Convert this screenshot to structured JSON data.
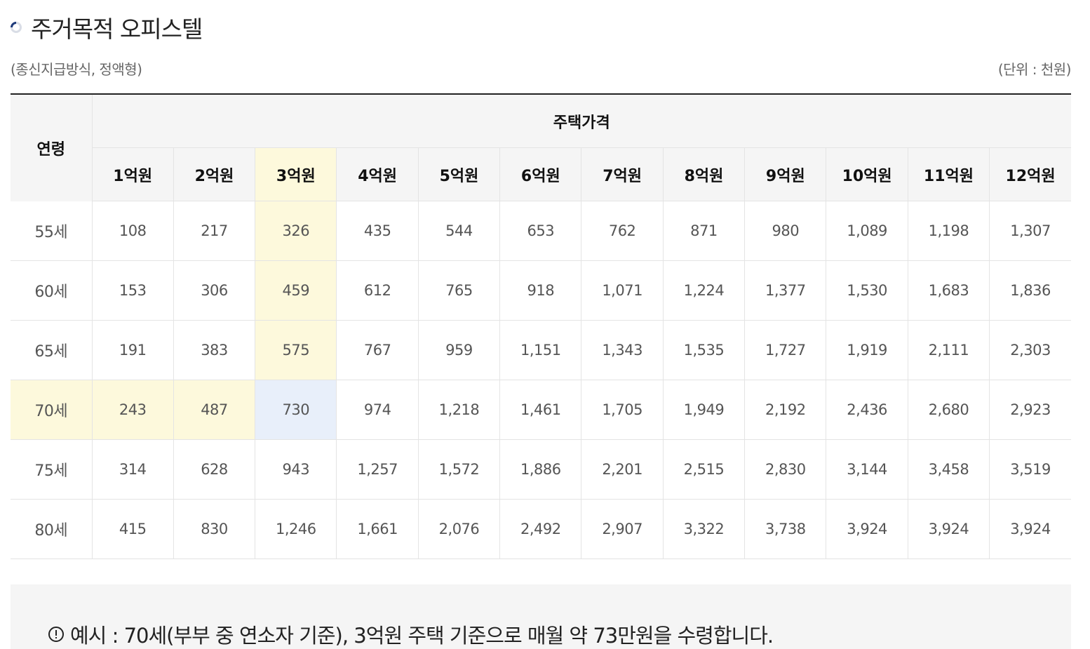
{
  "header": {
    "title": "주거목적 오피스텔",
    "subtitle": "(종신지급방식, 정액형)",
    "unit": "(단위 : 천원)"
  },
  "table": {
    "age_header": "연령",
    "price_header": "주택가격",
    "columns": [
      "1억원",
      "2억원",
      "3억원",
      "4억원",
      "5억원",
      "6억원",
      "7억원",
      "8억원",
      "9억원",
      "10억원",
      "11억원",
      "12억원"
    ],
    "rows": [
      {
        "age": "55세",
        "values": [
          "108",
          "217",
          "326",
          "435",
          "544",
          "653",
          "762",
          "871",
          "980",
          "1,089",
          "1,198",
          "1,307"
        ]
      },
      {
        "age": "60세",
        "values": [
          "153",
          "306",
          "459",
          "612",
          "765",
          "918",
          "1,071",
          "1,224",
          "1,377",
          "1,530",
          "1,683",
          "1,836"
        ]
      },
      {
        "age": "65세",
        "values": [
          "191",
          "383",
          "575",
          "767",
          "959",
          "1,151",
          "1,343",
          "1,535",
          "1,727",
          "1,919",
          "2,111",
          "2,303"
        ]
      },
      {
        "age": "70세",
        "values": [
          "243",
          "487",
          "730",
          "974",
          "1,218",
          "1,461",
          "1,705",
          "1,949",
          "2,192",
          "2,436",
          "2,680",
          "2,923"
        ]
      },
      {
        "age": "75세",
        "values": [
          "314",
          "628",
          "943",
          "1,257",
          "1,572",
          "1,886",
          "2,201",
          "2,515",
          "2,830",
          "3,144",
          "3,458",
          "3,519"
        ]
      },
      {
        "age": "80세",
        "values": [
          "415",
          "830",
          "1,246",
          "1,661",
          "2,076",
          "2,492",
          "2,907",
          "3,322",
          "3,738",
          "3,924",
          "3,924",
          "3,924"
        ]
      }
    ]
  },
  "note": {
    "icon": "exclamation-circle-icon",
    "text": "예시 : 70세(부부 중 연소자 기준), 3억원 주택 기준으로 매월 약 73만원을 수령합니다."
  },
  "colors": {
    "highlight_yellow": "#fdf9dc",
    "highlight_blue": "#e8effa",
    "header_bg": "#f5f5f5",
    "top_border": "#222222"
  }
}
